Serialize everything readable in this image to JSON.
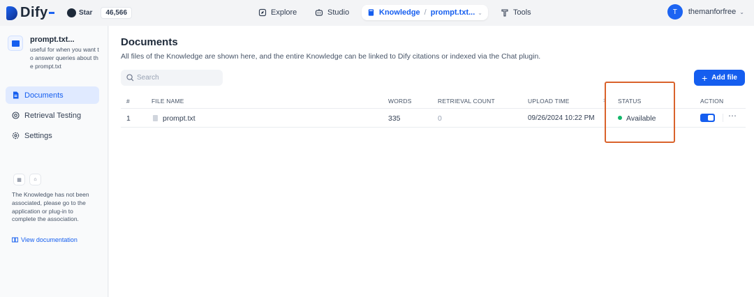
{
  "header": {
    "logo_text": "Dify",
    "github_star_label": "Star",
    "github_star_count": "46,566",
    "nav": [
      {
        "label": "Explore",
        "icon": "compass-icon"
      },
      {
        "label": "Studio",
        "icon": "robot-icon"
      },
      {
        "label": "Knowledge",
        "icon": "book-icon",
        "crumb": "prompt.txt...",
        "active": true
      },
      {
        "label": "Tools",
        "icon": "hammer-icon"
      }
    ],
    "user": {
      "initial": "T",
      "name": "themanforfree"
    }
  },
  "sidebar": {
    "dataset_name": "prompt.txt...",
    "dataset_desc": "useful for when you want to answer queries about the prompt.txt",
    "items": [
      {
        "label": "Documents",
        "icon": "document-icon",
        "active": true
      },
      {
        "label": "Retrieval Testing",
        "icon": "target-icon"
      },
      {
        "label": "Settings",
        "icon": "gear-icon"
      }
    ],
    "association_note": "The Knowledge has not been associated, please go to the application or plug-in to complete the association.",
    "view_doc_label": "View documentation"
  },
  "main": {
    "title": "Documents",
    "subtitle": "All files of the Knowledge are shown here, and the entire Knowledge can be linked to Dify citations or indexed via the Chat plugin.",
    "search_placeholder": "Search",
    "add_file_label": "Add file",
    "columns": [
      "#",
      "FILE NAME",
      "WORDS",
      "RETRIEVAL COUNT",
      "UPLOAD TIME",
      "STATUS",
      "ACTION"
    ],
    "rows": [
      {
        "index": "1",
        "file_name": "prompt.txt",
        "words": "335",
        "retrieval_count": "0",
        "upload_time": "09/26/2024 10:22 PM",
        "status": "Available",
        "enabled": true
      }
    ]
  },
  "colors": {
    "accent": "#155eef",
    "status_available": "#12b76a",
    "highlight_box": "#d9622b"
  }
}
